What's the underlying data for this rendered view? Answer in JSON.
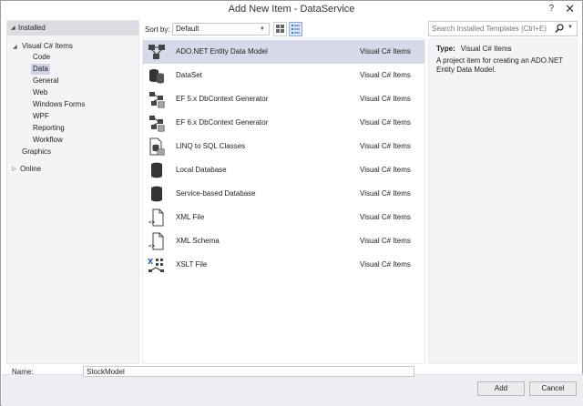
{
  "window": {
    "title": "Add New Item - DataService",
    "help_label": "?",
    "close_label": "✕"
  },
  "left_tree": {
    "installed": "Installed",
    "visual_csharp": "Visual C# Items",
    "children": [
      "Code",
      "Data",
      "General",
      "Web",
      "Windows Forms",
      "WPF",
      "Reporting",
      "Workflow"
    ],
    "graphics": "Graphics",
    "online": "Online"
  },
  "toolbar": {
    "sort_label": "Sort by:",
    "sort_value": "Default"
  },
  "search": {
    "placeholder": "Search Installed Templates (Ctrl+E)"
  },
  "templates": [
    {
      "name": "ADO.NET Entity Data Model",
      "type": "Visual C# Items",
      "icon": "entity-model-icon",
      "selected": true
    },
    {
      "name": "DataSet",
      "type": "Visual C# Items",
      "icon": "dataset-icon"
    },
    {
      "name": "EF 5.x DbContext Generator",
      "type": "Visual C# Items",
      "icon": "dbcontext-generator-icon"
    },
    {
      "name": "EF 6.x DbContext Generator",
      "type": "Visual C# Items",
      "icon": "dbcontext-generator-icon"
    },
    {
      "name": "LINQ to SQL Classes",
      "type": "Visual C# Items",
      "icon": "linq-classes-icon"
    },
    {
      "name": "Local Database",
      "type": "Visual C# Items",
      "icon": "database-icon"
    },
    {
      "name": "Service-based Database",
      "type": "Visual C# Items",
      "icon": "database-icon"
    },
    {
      "name": "XML File",
      "type": "Visual C# Items",
      "icon": "xml-file-icon"
    },
    {
      "name": "XML Schema",
      "type": "Visual C# Items",
      "icon": "xml-schema-icon"
    },
    {
      "name": "XSLT File",
      "type": "Visual C# Items",
      "icon": "xslt-file-icon"
    }
  ],
  "description": {
    "type_label": "Type:",
    "type_value": "Visual C# Items",
    "text": "A project item for creating an ADO.NET Entity Data Model."
  },
  "name_field": {
    "label": "Name:",
    "value": "StockModel"
  },
  "buttons": {
    "add": "Add",
    "cancel": "Cancel"
  },
  "colors": {
    "selection": "#d5d9ea",
    "pane_bg": "#f4f4f6",
    "accent": "#3c6eb4"
  }
}
